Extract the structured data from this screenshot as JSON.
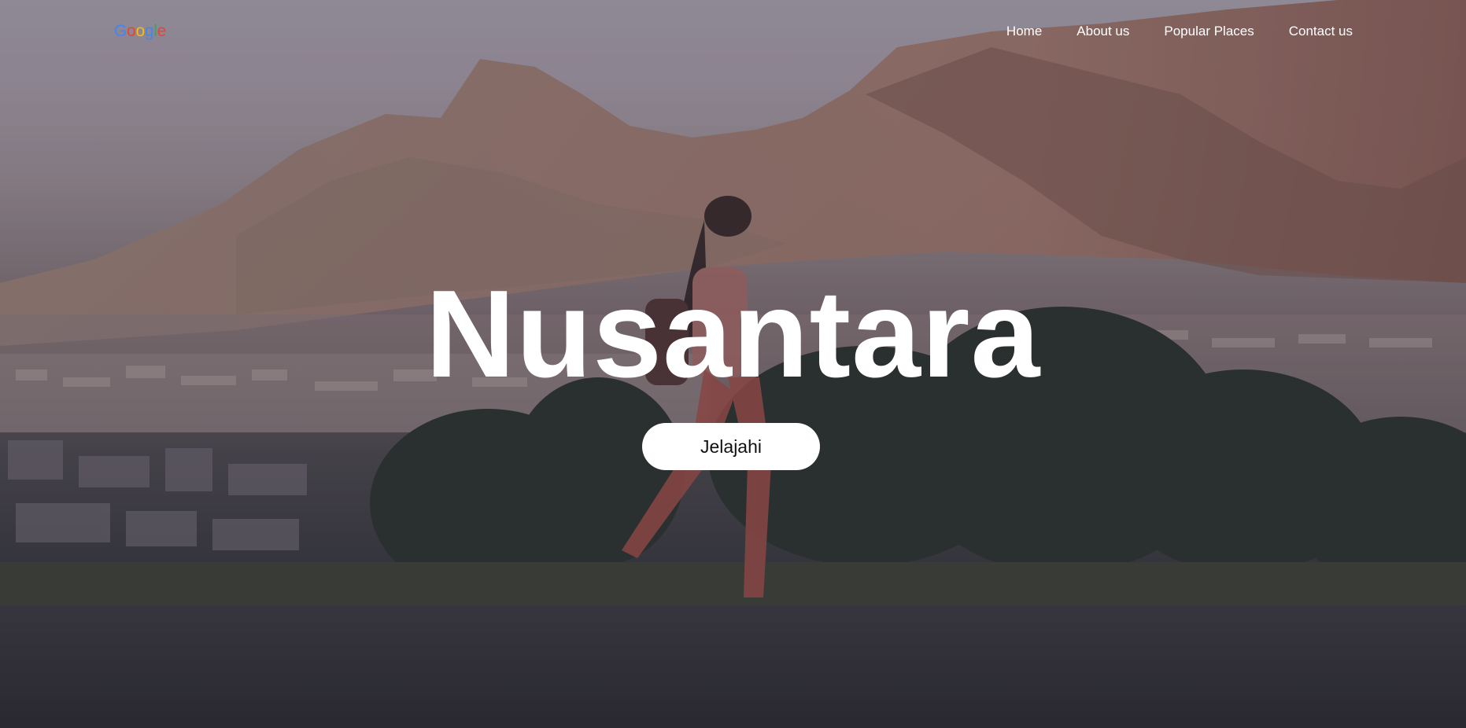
{
  "nav": {
    "logo": {
      "letters": [
        "G",
        "o",
        "o",
        "g",
        "l",
        "e"
      ],
      "colors": [
        "#4285F4",
        "#EA4335",
        "#FBBC05",
        "#4285F4",
        "#34A853",
        "#EA4335"
      ]
    },
    "links": [
      "Home",
      "About us",
      "Popular Places",
      "Contact us"
    ]
  },
  "hero": {
    "title": "Nusantara",
    "cta_label": "Jelajahi",
    "background_icon": "mountain-landscape-photo"
  }
}
